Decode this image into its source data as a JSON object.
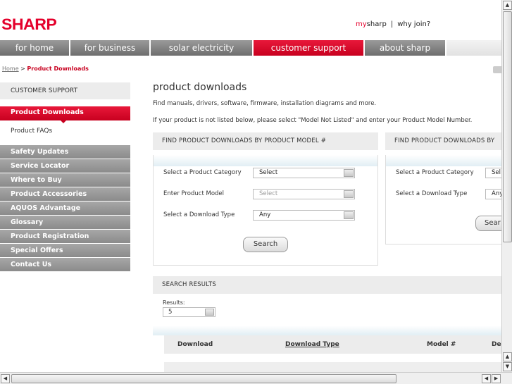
{
  "header": {
    "logo": "SHARP",
    "my_prefix": "my",
    "my_sharp": "sharp",
    "separator": "|",
    "why_join": "why join?"
  },
  "nav": {
    "tabs": [
      {
        "label": "for home"
      },
      {
        "label": "for business"
      },
      {
        "label": "solar electricity"
      },
      {
        "label": "customer support"
      },
      {
        "label": "about sharp"
      }
    ]
  },
  "breadcrumb": {
    "home": "Home",
    "separator": ">",
    "current": "Product Downloads"
  },
  "sidebar": {
    "heading": "CUSTOMER SUPPORT",
    "active": "Product Downloads",
    "faq": "Product FAQs",
    "items": [
      {
        "label": "Safety Updates"
      },
      {
        "label": "Service Locator"
      },
      {
        "label": "Where to Buy"
      },
      {
        "label": "Product Accessories"
      },
      {
        "label": "AQUOS Advantage"
      },
      {
        "label": "Glossary"
      },
      {
        "label": "Product Registration"
      },
      {
        "label": "Special Offers"
      },
      {
        "label": "Contact Us"
      }
    ]
  },
  "main": {
    "title": "product downloads",
    "desc1": "Find manuals, drivers, software, firmware, installation diagrams and more.",
    "desc2": "If your product is not listed below, please select \"Model Not Listed\" and enter your Product Model Number.",
    "panel1": {
      "heading": "FIND PRODUCT DOWNLOADS BY PRODUCT MODEL #",
      "category_label": "Select a Product Category",
      "category_value": "Select",
      "model_label": "Enter Product Model",
      "model_value": "Select",
      "type_label": "Select a Download Type",
      "type_value": "Any",
      "search": "Search"
    },
    "panel2": {
      "heading": "FIND PRODUCT DOWNLOADS BY",
      "category_label": "Select a Product Category",
      "category_value": "Sel",
      "type_label": "Select a Download Type",
      "type_value": "Any",
      "search": "Sear"
    },
    "results": {
      "heading": "SEARCH RESULTS",
      "label": "Results:",
      "value": "5",
      "columns": [
        "Download",
        "Download Type",
        "Model #",
        "De"
      ]
    }
  },
  "colors": {
    "brand_red": "#e4002b",
    "nav_gray": "#7f7f7f"
  }
}
